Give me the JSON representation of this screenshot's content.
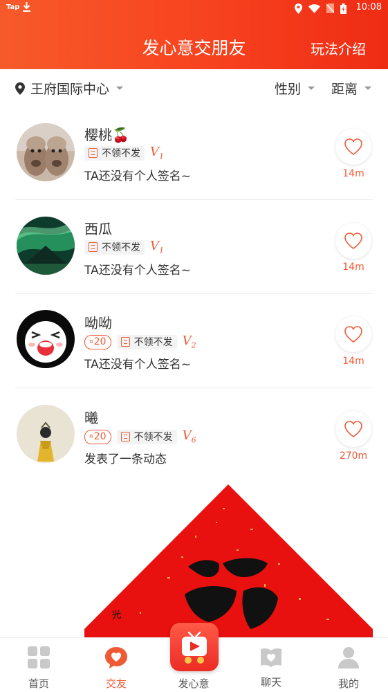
{
  "status_bar": {
    "app_label": "Tap",
    "time": "10:08"
  },
  "header": {
    "title": "发心意交朋友",
    "rules_link": "玩法介绍"
  },
  "filter_bar": {
    "location": "王府国际中心",
    "gender_filter": "性别",
    "distance_filter": "距离"
  },
  "users": [
    {
      "name": "樱桃🍒",
      "coin_tag": "",
      "tag": "不领不发",
      "level": "V",
      "level_num": "1",
      "signature": "TA还没有个人签名~",
      "distance": "14m"
    },
    {
      "name": "西瓜",
      "coin_tag": "",
      "tag": "不领不发",
      "level": "V",
      "level_num": "1",
      "signature": "TA还没有个人签名~",
      "distance": "14m"
    },
    {
      "name": "呦呦",
      "coin_tag": "20",
      "tag": "不领不发",
      "level": "V",
      "level_num": "2",
      "signature": "TA还没有个人签名~",
      "distance": "14m"
    },
    {
      "name": "曦",
      "coin_tag": "20",
      "tag": "不领不发",
      "level": "V",
      "level_num": "6",
      "signature": "发表了一条动态",
      "distance": "270m"
    }
  ],
  "tab_bar": {
    "home": "首页",
    "friends": "交友",
    "send_heart": "发心意",
    "chat": "聊天",
    "mine": "我的"
  },
  "colors": {
    "accent": "#ef5a36",
    "header_start": "#f75a2a",
    "header_end": "#ee2c14"
  }
}
